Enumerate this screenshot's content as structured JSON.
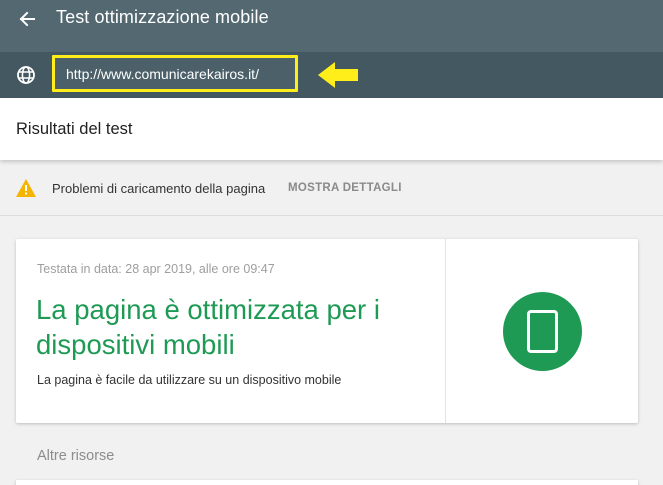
{
  "header": {
    "title": "Test ottimizzazione mobile",
    "back_icon": "arrow-back-icon",
    "bg_color": "#536870"
  },
  "url_bar": {
    "value": "http://www.comunicarekairos.it/",
    "globe_icon": "globe-icon",
    "highlight_color": "#ffee1a",
    "annotation_icon": "yellow-arrow-icon"
  },
  "results": {
    "title": "Risultati del test"
  },
  "warning": {
    "icon": "warning-icon",
    "icon_color": "#f4b400",
    "text": "Problemi di caricamento della pagina",
    "link": "MOSTRA DETTAGLI"
  },
  "result_card": {
    "tested_on": "Testata in data: 28 apr 2019, alle ore 09:47",
    "headline": "La pagina è ottimizzata per i dispositivi mobili",
    "description": "La pagina è facile da utilizzare su un dispositivo mobile",
    "icon": "mobile-phone-icon",
    "accent_color": "#1f9a55"
  },
  "other_resources": {
    "label": "Altre risorse"
  }
}
